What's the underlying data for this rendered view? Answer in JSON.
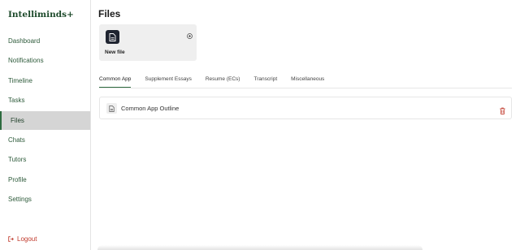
{
  "brand": "Intelliminds+",
  "nav": [
    {
      "label": "Dashboard"
    },
    {
      "label": "Notifications"
    },
    {
      "label": "Timeline"
    },
    {
      "label": "Tasks"
    },
    {
      "label": "Files",
      "active": true
    },
    {
      "label": "Chats"
    },
    {
      "label": "Tutors"
    },
    {
      "label": "Profile"
    },
    {
      "label": "Settings"
    }
  ],
  "logout": "Logout",
  "page": {
    "title": "Files",
    "new_file_label": "New file",
    "tabs": [
      "Common App",
      "Supplement Essays",
      "Resume (ECs)",
      "Transcript",
      "Miscellaneous"
    ],
    "active_tab": "Common App",
    "files": [
      {
        "name": "Common App Outline"
      }
    ]
  },
  "colors": {
    "accent": "#2e6b3f",
    "danger": "#c0392b",
    "card_bg": "#efefef"
  }
}
